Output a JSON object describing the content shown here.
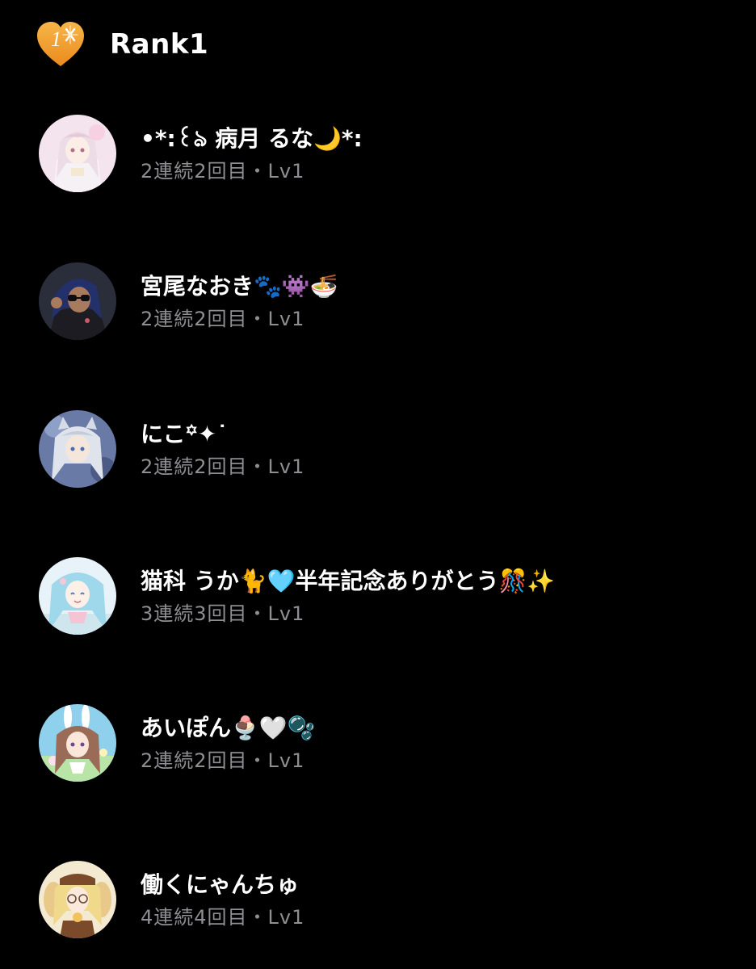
{
  "header": {
    "badge_icon": "rank-1-heart-badge",
    "badge_number": "1",
    "title": "Rank1"
  },
  "colors": {
    "background": "#000000",
    "badge": "#f0a030",
    "meta_text": "#8e8e93"
  },
  "users": [
    {
      "name": "•*:꒰ঌ 病月 るな🌙*:",
      "streak": "2連続2回目",
      "separator": "・",
      "level": "Lv1",
      "avatar_icon": "pink-haired-anime-avatar"
    },
    {
      "name": "宮尾なおき🐾👾🍜",
      "streak": "2連続2回目",
      "separator": "・",
      "level": "Lv1",
      "avatar_icon": "dark-haired-sunglasses-avatar"
    },
    {
      "name": "にこ꙳✦˙",
      "streak": "2連続2回目",
      "separator": "・",
      "level": "Lv1",
      "avatar_icon": "silver-haired-cat-ear-avatar"
    },
    {
      "name": "猫科 うか🐈🩵半年記念ありがとう🎊✨",
      "streak": "3連続3回目",
      "separator": "・",
      "level": "Lv1",
      "avatar_icon": "light-blue-haired-avatar"
    },
    {
      "name": "あいぽん🍨🤍🫧",
      "streak": "2連続2回目",
      "separator": "・",
      "level": "Lv1",
      "avatar_icon": "bunny-ear-brown-haired-avatar"
    },
    {
      "name": "働くにゃんちゅ",
      "streak": "4連続4回目",
      "separator": "・",
      "level": "Lv1",
      "avatar_icon": "blonde-glasses-avatar"
    }
  ]
}
